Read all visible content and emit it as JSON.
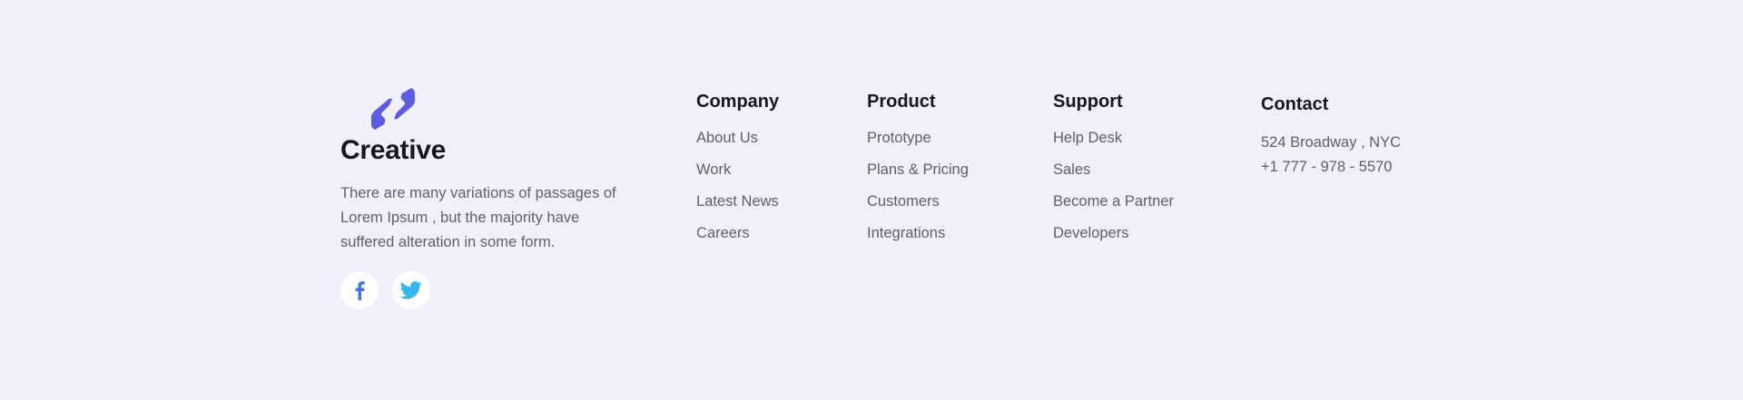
{
  "brand": {
    "logo_icon": "creative-logo-icon",
    "name": "Creative",
    "description": "There are many variations of passages of Lorem Ipsum , but the majority have suffered alteration in some form.",
    "accent_color": "#5b5be6",
    "socials": [
      {
        "icon": "facebook-icon",
        "color": "#3c74e6"
      },
      {
        "icon": "twitter-icon",
        "color": "#34b6ee"
      }
    ]
  },
  "columns": [
    {
      "title": "Company",
      "links": [
        "About Us",
        "Work",
        "Latest News",
        "Careers"
      ]
    },
    {
      "title": "Product",
      "links": [
        "Prototype",
        "Plans & Pricing",
        "Customers",
        "Integrations"
      ]
    },
    {
      "title": "Support",
      "links": [
        "Help Desk",
        "Sales",
        "Become a Partner",
        "Developers"
      ]
    }
  ],
  "contact": {
    "title": "Contact",
    "address": "524 Broadway , NYC",
    "phone": "+1 777 - 978 - 5570"
  },
  "colors": {
    "background": "#f0f0fd",
    "heading": "#16171c",
    "body_text": "#5e5f6a"
  }
}
